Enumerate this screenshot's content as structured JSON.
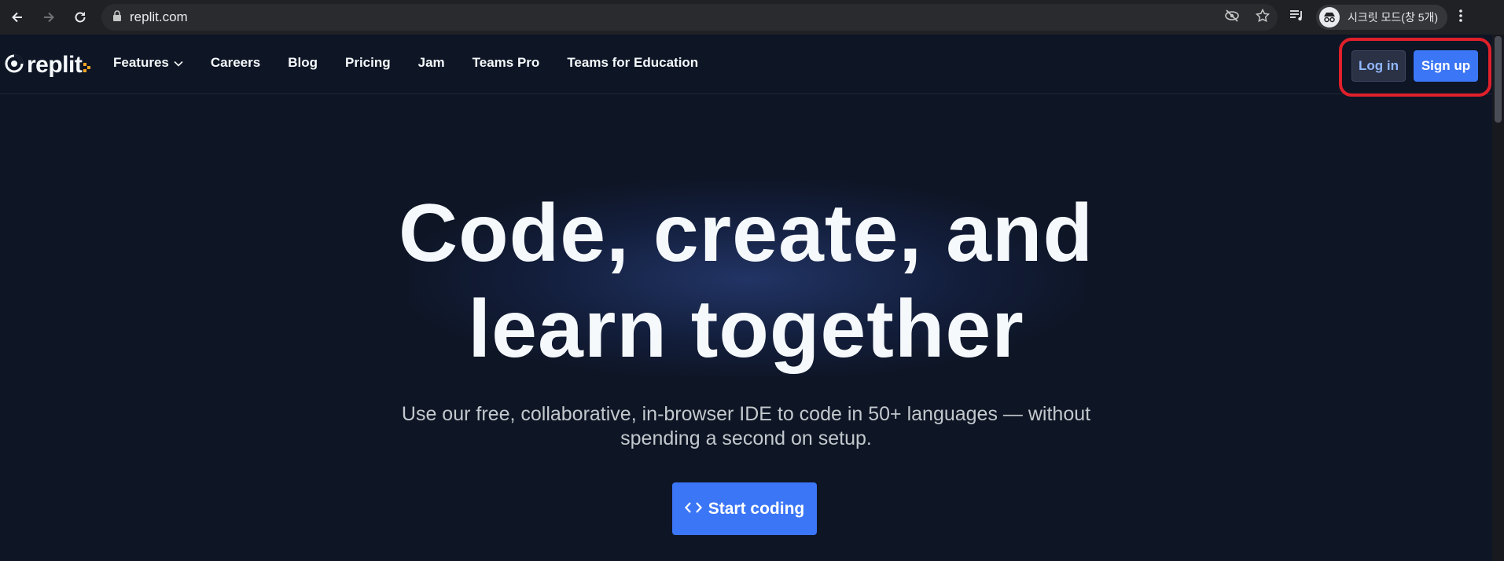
{
  "browser": {
    "url": "replit.com",
    "profile_label": "시크릿 모드(창 5개)"
  },
  "site": {
    "logo_text": "replit",
    "nav": [
      {
        "label": "Features"
      },
      {
        "label": "Careers"
      },
      {
        "label": "Blog"
      },
      {
        "label": "Pricing"
      },
      {
        "label": "Jam"
      },
      {
        "label": "Teams Pro"
      },
      {
        "label": "Teams for Education"
      }
    ],
    "login_label": "Log in",
    "signup_label": "Sign up"
  },
  "hero": {
    "title_line1": "Code, create, and",
    "title_line2": "learn together",
    "subtitle_line1": "Use our free, collaborative, in-browser IDE to code in 50+ languages — without",
    "subtitle_line2": "spending a second on setup.",
    "cta_label": "Start coding"
  },
  "colors": {
    "background": "#0e1525",
    "accent": "#3b76f6",
    "highlight": "#e0202a",
    "logo_accent": "#f5a623"
  }
}
